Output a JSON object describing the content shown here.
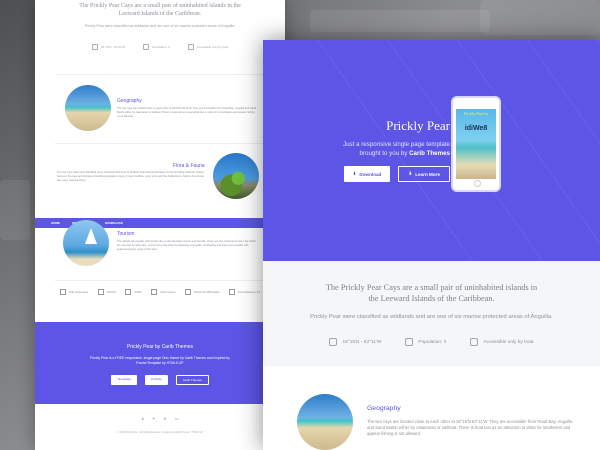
{
  "back": {
    "intro_heading": "The Prickly Pear Cays are a small pair of uninhabited islands in the Leeward Islands of the Caribbean.",
    "intro_sub": "Prickly Pear were classified as wildlands and are one of six marine protected areas of Anguilla.",
    "stats": [
      "18°15'N - 63°11'W",
      "Population: 0",
      "Accessible only by boat"
    ],
    "sections": [
      {
        "title": "Geography",
        "text": "The two cays are located close to each other at 18°15'N 63°11'W. They are accessible from Road Bay, Anguilla and Sand Martin either by catamaran or sailboat. There is boat taxi as a real attraction to visits for to snorkelers and appear fishing is not allowed."
      },
      {
        "title": "Flora & Fauna",
        "text": "The two cays have been identified as an Important Bird Area by BirdLife International because of their breeding seabirds. Marine fauna on the cays and include a breeding population colony, brown boobies, sooty terns and the bridled terns. Marine lizards are also seen roaming along."
      },
      {
        "title": "Tourism",
        "text": "The islands are popular with tourists due to the abundant marine and land life. There are two restaurants and a bar which are serviced by daily trips, cool to serve day boat trip departing at Anguilla. Snorkelling and diving are possible with seasonal options equip at the area."
      }
    ],
    "nav": [
      "HOME",
      "INFORMATION",
      "DOWNLOAD"
    ],
    "features": [
      "Fully responsive",
      "HTML5",
      "CSS3",
      "Open source",
      "Photos by Wikimedia",
      "Font Awesome 4.6"
    ],
    "footer_title": "Prickly Pear by Carib Themes",
    "footer_desc": "Prickly Pear is a FREE responsive, single page Onix theme by Carib Themes and inspired by Fractal Template by HTML5 UP.",
    "footer_buttons": [
      "Templates",
      "Portfolio",
      "Carib Themes"
    ],
    "social": [
      "github-icon",
      "twitter-icon",
      "send-icon",
      "desktop-icon"
    ],
    "copyright": "© 2016 Prickly Pear · All Rights Reserved · Designed by Carib Themes · HTML5 UP"
  },
  "front": {
    "hero": {
      "title": "Prickly Pear",
      "desc_line1": "Just a responsive single page template",
      "desc_line2_prefix": "brought to you by",
      "desc_brand": "Carib Themes",
      "download_label": "Download",
      "learn_more_label": "Learn More",
      "phone_screen_title": "Prickly Pear by",
      "phone_screen_brand": "idiWe8"
    },
    "intro": {
      "heading": "The Prickly Pear Cays are a small pair of uninhabited islands in the Leeward Islands of the Caribbean.",
      "sub": "Prickly Pear were classified as wildlands and are one of six marine protected areas of Anguilla.",
      "stats": [
        "18°15'N - 63°11'W",
        "Population: 0",
        "Accessible only by boat"
      ]
    },
    "geography": {
      "title": "Geography",
      "text": "The two cays are located close to each other at 18°15'N 63°11'W. They are accessible from Road Bay, Anguilla and Sand Martin either by catamaran or sailboat. There is boat taxi as an attraction to visits for snorkelers and appear fishing is not allowed."
    }
  },
  "colors": {
    "accent": "#5c55e6",
    "background": "#6c6d70"
  }
}
